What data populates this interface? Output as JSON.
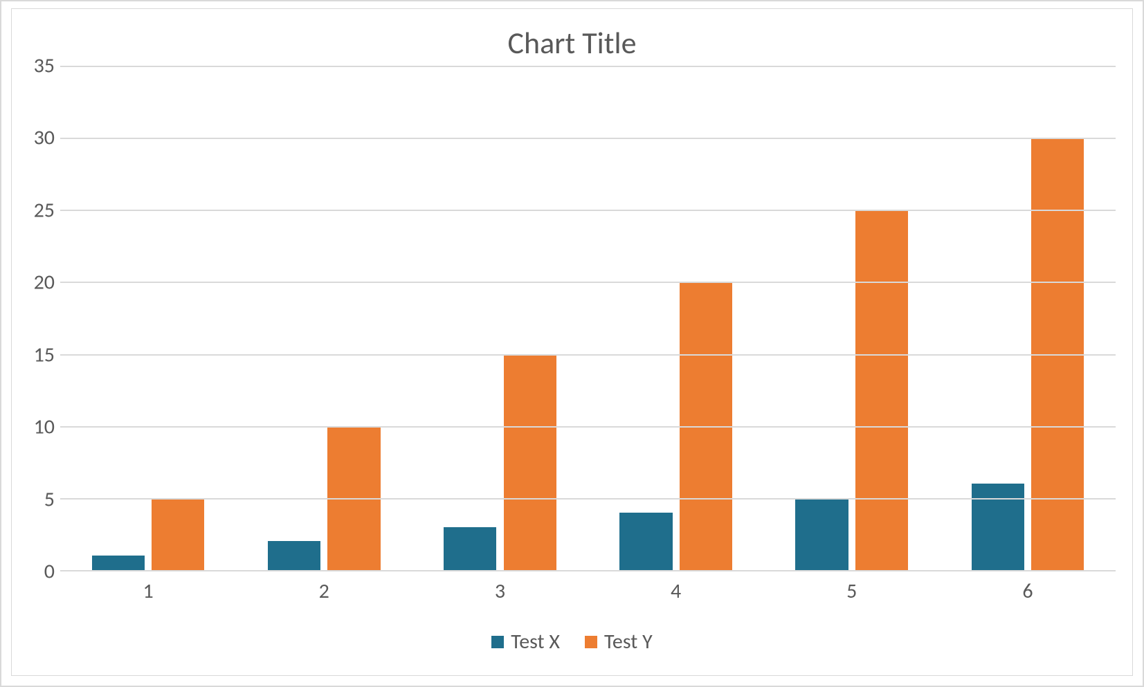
{
  "chart_data": {
    "type": "bar",
    "title": "Chart Title",
    "categories": [
      "1",
      "2",
      "3",
      "4",
      "5",
      "6"
    ],
    "series": [
      {
        "name": "Test X",
        "values": [
          1,
          2,
          3,
          4,
          5,
          6
        ],
        "color": "#1f6e8c"
      },
      {
        "name": "Test Y",
        "values": [
          5,
          10,
          15,
          20,
          25,
          30
        ],
        "color": "#ed7d31"
      }
    ],
    "xlabel": "",
    "ylabel": "",
    "ylim": [
      0,
      35
    ],
    "yticks": [
      0,
      5,
      10,
      15,
      20,
      25,
      30,
      35
    ],
    "legend_position": "bottom",
    "grid": true
  }
}
